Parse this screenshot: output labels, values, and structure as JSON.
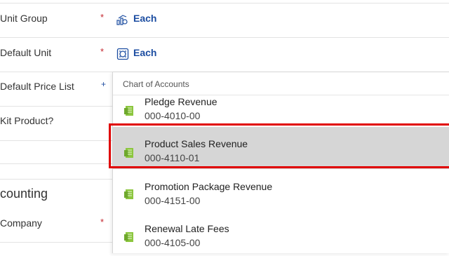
{
  "form": {
    "fields": [
      {
        "label": "Unit Group",
        "required_mark": "*",
        "value": "Each",
        "icon": "unit-group-icon"
      },
      {
        "label": "Default Unit",
        "required_mark": "*",
        "value": "Each",
        "icon": "unit-icon"
      },
      {
        "label": "Default Price List",
        "required_mark": "+"
      },
      {
        "label": "Kit Product?"
      }
    ],
    "section_title": "counting",
    "company": {
      "label": "Company",
      "required_mark": "*"
    }
  },
  "dropdown": {
    "header": "Chart of Accounts",
    "items": [
      {
        "name": "Pledge Revenue",
        "code": "000-4010-00",
        "icon": "account-icon"
      },
      {
        "name": "Product Sales Revenue",
        "code": "000-4110-01",
        "icon": "account-icon",
        "selected": true
      },
      {
        "name": "Promotion Package Revenue",
        "code": "000-4151-00",
        "icon": "account-icon"
      },
      {
        "name": "Renewal Late Fees",
        "code": "000-4105-00",
        "icon": "account-icon"
      }
    ]
  },
  "colors": {
    "link": "#1c4da1",
    "required": "#c4262e",
    "selected_bg": "#d6d6d6",
    "highlight": "#e00000",
    "icon_green": "#8cc63f"
  }
}
